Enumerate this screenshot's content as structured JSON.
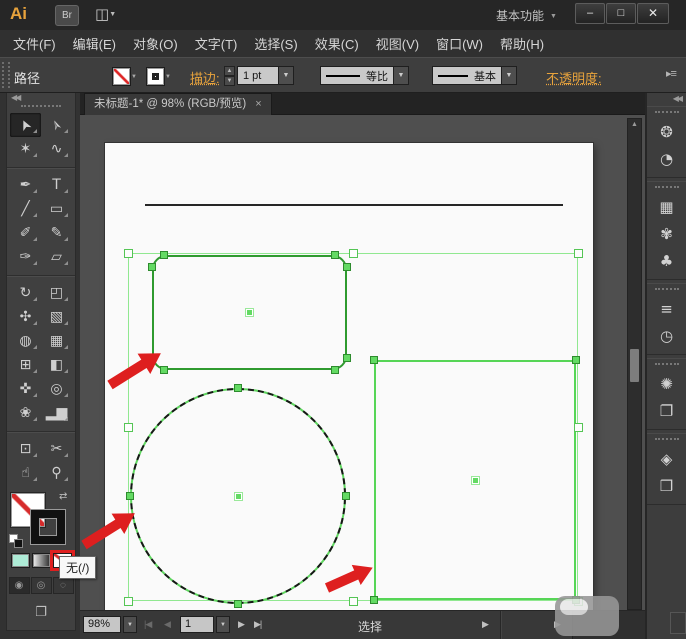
{
  "window": {
    "app_logo": "Ai",
    "bridge_button": "Br",
    "layout_glyph": "◫",
    "workspace_switcher": "基本功能",
    "minimize_glyph": "–",
    "maximize_glyph": "□",
    "close_glyph": "✕"
  },
  "menu_bar": {
    "items": [
      "文件(F)",
      "编辑(E)",
      "对象(O)",
      "文字(T)",
      "选择(S)",
      "效果(C)",
      "视图(V)",
      "窗口(W)",
      "帮助(H)"
    ]
  },
  "control_bar": {
    "selection_label": "路径",
    "stroke_label": "描边:",
    "stroke_weight": "1 pt",
    "width_profile": "等比",
    "brush_definition": "基本",
    "opacity_label": "不透明度:",
    "panel_menu_glyph": "▸≡",
    "dropdown_glyph": "▼",
    "step_up_glyph": "▲",
    "step_down_glyph": "▼"
  },
  "document_tab": {
    "title": "未标题-1* @ 98% (RGB/预览)",
    "close_glyph": "×"
  },
  "toolbar": {
    "collapse_glyph": "◀◀",
    "tools": [
      {
        "name": "selection",
        "glyph": "➤",
        "selected": true
      },
      {
        "name": "direct-selection",
        "glyph": "➢"
      },
      {
        "name": "magic-wand",
        "glyph": "✶"
      },
      {
        "name": "lasso",
        "glyph": "∿"
      },
      {
        "name": "pen",
        "glyph": "✒"
      },
      {
        "name": "type",
        "glyph": "T"
      },
      {
        "name": "line-segment",
        "glyph": "╱"
      },
      {
        "name": "rectangle",
        "glyph": "▭"
      },
      {
        "name": "paintbrush",
        "glyph": "✐"
      },
      {
        "name": "pencil",
        "glyph": "✎"
      },
      {
        "name": "blob-brush",
        "glyph": "✑"
      },
      {
        "name": "eraser",
        "glyph": "▱"
      },
      {
        "name": "rotate",
        "glyph": "↻"
      },
      {
        "name": "scale",
        "glyph": "◰"
      },
      {
        "name": "width",
        "glyph": "✣"
      },
      {
        "name": "free-transform",
        "glyph": "▧"
      },
      {
        "name": "shape-builder",
        "glyph": "◍"
      },
      {
        "name": "perspective-grid",
        "glyph": "▦"
      },
      {
        "name": "mesh",
        "glyph": "⊞"
      },
      {
        "name": "gradient",
        "glyph": "◧"
      },
      {
        "name": "eyedropper",
        "glyph": "✜"
      },
      {
        "name": "blend",
        "glyph": "◎"
      },
      {
        "name": "symbol-sprayer",
        "glyph": "❀"
      },
      {
        "name": "column-graph",
        "glyph": "▂▆"
      },
      {
        "name": "artboard",
        "glyph": "⊡"
      },
      {
        "name": "slice",
        "glyph": "✂"
      },
      {
        "name": "hand",
        "glyph": "☝"
      },
      {
        "name": "zoom",
        "glyph": "⚲"
      }
    ],
    "swatches": {
      "swap_glyph": "⇄"
    },
    "drawing_modes": [
      {
        "name": "draw-normal",
        "glyph": "◉"
      },
      {
        "name": "draw-behind",
        "glyph": "◎"
      },
      {
        "name": "draw-inside",
        "glyph": "◌"
      }
    ],
    "screen_mode_glyph": "❐",
    "tooltip": "无(/)"
  },
  "dock": {
    "collapse_glyph": "◀◀",
    "groups": [
      [
        {
          "name": "color-panel",
          "glyph": "❂"
        },
        {
          "name": "gradient-panel",
          "glyph": "◔"
        }
      ],
      [
        {
          "name": "swatches-panel",
          "glyph": "▦"
        },
        {
          "name": "brushes-panel",
          "glyph": "✾"
        },
        {
          "name": "symbols-panel",
          "glyph": "♣"
        }
      ],
      [
        {
          "name": "stroke-panel",
          "glyph": "≡"
        },
        {
          "name": "transparency-panel",
          "glyph": "◷"
        }
      ],
      [
        {
          "name": "appearance-panel",
          "glyph": "✺"
        },
        {
          "name": "graphic-styles-panel",
          "glyph": "❐"
        }
      ],
      [
        {
          "name": "layers-panel",
          "glyph": "◈"
        },
        {
          "name": "artboards-panel",
          "glyph": "❒"
        }
      ]
    ]
  },
  "status_bar": {
    "zoom_level": "98%",
    "first_glyph": "|◀",
    "prev_glyph": "◀",
    "artboard_number": "1",
    "next_glyph": "▶",
    "last_glyph": "▶|",
    "status_text": "选择",
    "flyout_glyph": "▶",
    "scroll_glyph": "▶",
    "dropdown_glyph": "▼"
  },
  "scrollbar": {
    "up_glyph": "▲"
  },
  "canvas": {
    "shape_names": [
      "divider-line",
      "rounded-rectangle",
      "ellipse",
      "rectangle"
    ],
    "annotations": [
      "arrow-to-rounded-rectangle",
      "arrow-to-ellipse",
      "arrow-to-rectangle",
      "highlight-box-none-swatch"
    ]
  },
  "colors": {
    "accent-orange": "#e8a33c",
    "selection-green": "#5bd65b",
    "selection-green-dim": "#90e890",
    "annotation-red": "#de1f1f",
    "mint": "#aeebd6"
  }
}
